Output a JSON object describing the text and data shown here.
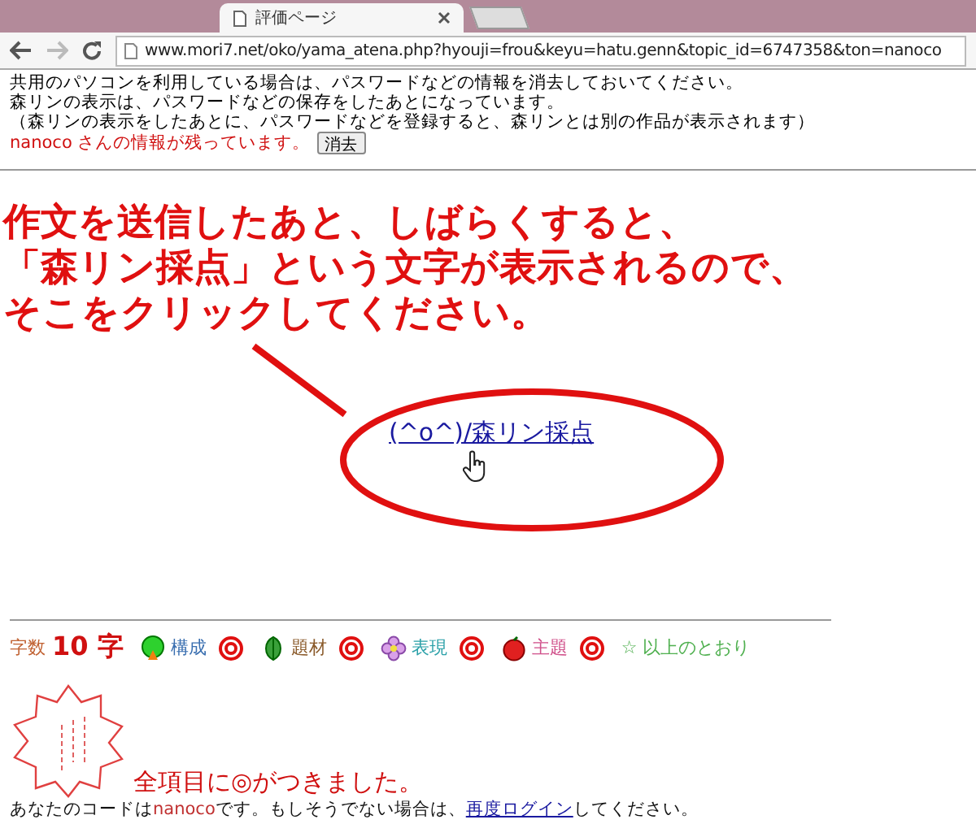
{
  "browser": {
    "tab_title": "評価ページ",
    "url": "www.mori7.net/oko/yama_atena.php?hyouji=frou&keyu=hatu.genn&topic_id=6747358&ton=nanoco"
  },
  "notices": [
    "共用のパソコンを利用している場合は、パスワードなどの情報を消去しておいてください。",
    "森リンの表示は、パスワードなどの保存をしたあとになっています。",
    "（森リンの表示をしたあとに、パスワードなどを登録すると、森リンとは別の作品が表示されます）"
  ],
  "user_notice": {
    "text": "nanoco さんの情報が残っています。",
    "button": "消去"
  },
  "annotation": {
    "lines": [
      "作文を送信したあと、しばらくすると、",
      "「森リン採点」という文字が表示されるので、",
      "そこをクリックしてください。"
    ]
  },
  "score_link": "(^o^)/森リン採点",
  "ratings": {
    "count_label": "字数",
    "count": "10 字",
    "items": [
      {
        "kind": "tree",
        "label": "構成",
        "color": "#3a6fb0"
      },
      {
        "kind": "leaf",
        "label": "題材",
        "color": "#8a5a2a"
      },
      {
        "kind": "flower",
        "label": "表現",
        "color": "#2aa0a8"
      },
      {
        "kind": "apple",
        "label": "主題",
        "color": "#d0508a"
      }
    ],
    "summary": "☆ 以上のとおり"
  },
  "result": "全項目に◎がつきました。",
  "footer": {
    "before": "あなたのコードは",
    "code": "nanoco",
    "middle": "です。もしそうでない場合は、",
    "link": "再度ログイン",
    "after": "してください。"
  }
}
